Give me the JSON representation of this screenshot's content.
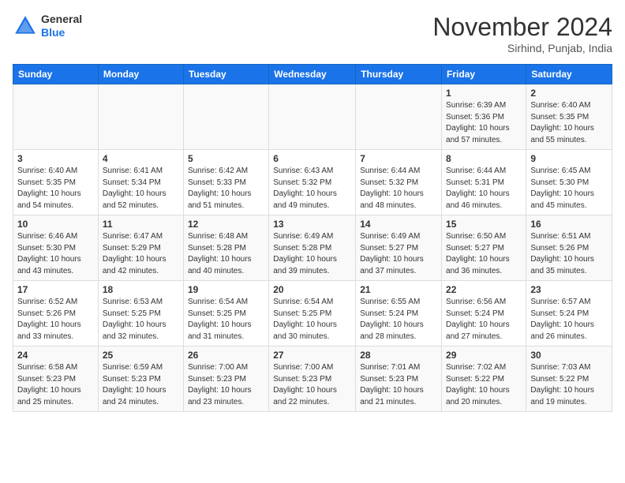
{
  "header": {
    "logo": {
      "general": "General",
      "blue": "Blue"
    },
    "title": "November 2024",
    "location": "Sirhind, Punjab, India"
  },
  "weekdays": [
    "Sunday",
    "Monday",
    "Tuesday",
    "Wednesday",
    "Thursday",
    "Friday",
    "Saturday"
  ],
  "weeks": [
    [
      {
        "day": "",
        "info": ""
      },
      {
        "day": "",
        "info": ""
      },
      {
        "day": "",
        "info": ""
      },
      {
        "day": "",
        "info": ""
      },
      {
        "day": "",
        "info": ""
      },
      {
        "day": "1",
        "info": "Sunrise: 6:39 AM\nSunset: 5:36 PM\nDaylight: 10 hours and 57 minutes."
      },
      {
        "day": "2",
        "info": "Sunrise: 6:40 AM\nSunset: 5:35 PM\nDaylight: 10 hours and 55 minutes."
      }
    ],
    [
      {
        "day": "3",
        "info": "Sunrise: 6:40 AM\nSunset: 5:35 PM\nDaylight: 10 hours and 54 minutes."
      },
      {
        "day": "4",
        "info": "Sunrise: 6:41 AM\nSunset: 5:34 PM\nDaylight: 10 hours and 52 minutes."
      },
      {
        "day": "5",
        "info": "Sunrise: 6:42 AM\nSunset: 5:33 PM\nDaylight: 10 hours and 51 minutes."
      },
      {
        "day": "6",
        "info": "Sunrise: 6:43 AM\nSunset: 5:32 PM\nDaylight: 10 hours and 49 minutes."
      },
      {
        "day": "7",
        "info": "Sunrise: 6:44 AM\nSunset: 5:32 PM\nDaylight: 10 hours and 48 minutes."
      },
      {
        "day": "8",
        "info": "Sunrise: 6:44 AM\nSunset: 5:31 PM\nDaylight: 10 hours and 46 minutes."
      },
      {
        "day": "9",
        "info": "Sunrise: 6:45 AM\nSunset: 5:30 PM\nDaylight: 10 hours and 45 minutes."
      }
    ],
    [
      {
        "day": "10",
        "info": "Sunrise: 6:46 AM\nSunset: 5:30 PM\nDaylight: 10 hours and 43 minutes."
      },
      {
        "day": "11",
        "info": "Sunrise: 6:47 AM\nSunset: 5:29 PM\nDaylight: 10 hours and 42 minutes."
      },
      {
        "day": "12",
        "info": "Sunrise: 6:48 AM\nSunset: 5:28 PM\nDaylight: 10 hours and 40 minutes."
      },
      {
        "day": "13",
        "info": "Sunrise: 6:49 AM\nSunset: 5:28 PM\nDaylight: 10 hours and 39 minutes."
      },
      {
        "day": "14",
        "info": "Sunrise: 6:49 AM\nSunset: 5:27 PM\nDaylight: 10 hours and 37 minutes."
      },
      {
        "day": "15",
        "info": "Sunrise: 6:50 AM\nSunset: 5:27 PM\nDaylight: 10 hours and 36 minutes."
      },
      {
        "day": "16",
        "info": "Sunrise: 6:51 AM\nSunset: 5:26 PM\nDaylight: 10 hours and 35 minutes."
      }
    ],
    [
      {
        "day": "17",
        "info": "Sunrise: 6:52 AM\nSunset: 5:26 PM\nDaylight: 10 hours and 33 minutes."
      },
      {
        "day": "18",
        "info": "Sunrise: 6:53 AM\nSunset: 5:25 PM\nDaylight: 10 hours and 32 minutes."
      },
      {
        "day": "19",
        "info": "Sunrise: 6:54 AM\nSunset: 5:25 PM\nDaylight: 10 hours and 31 minutes."
      },
      {
        "day": "20",
        "info": "Sunrise: 6:54 AM\nSunset: 5:25 PM\nDaylight: 10 hours and 30 minutes."
      },
      {
        "day": "21",
        "info": "Sunrise: 6:55 AM\nSunset: 5:24 PM\nDaylight: 10 hours and 28 minutes."
      },
      {
        "day": "22",
        "info": "Sunrise: 6:56 AM\nSunset: 5:24 PM\nDaylight: 10 hours and 27 minutes."
      },
      {
        "day": "23",
        "info": "Sunrise: 6:57 AM\nSunset: 5:24 PM\nDaylight: 10 hours and 26 minutes."
      }
    ],
    [
      {
        "day": "24",
        "info": "Sunrise: 6:58 AM\nSunset: 5:23 PM\nDaylight: 10 hours and 25 minutes."
      },
      {
        "day": "25",
        "info": "Sunrise: 6:59 AM\nSunset: 5:23 PM\nDaylight: 10 hours and 24 minutes."
      },
      {
        "day": "26",
        "info": "Sunrise: 7:00 AM\nSunset: 5:23 PM\nDaylight: 10 hours and 23 minutes."
      },
      {
        "day": "27",
        "info": "Sunrise: 7:00 AM\nSunset: 5:23 PM\nDaylight: 10 hours and 22 minutes."
      },
      {
        "day": "28",
        "info": "Sunrise: 7:01 AM\nSunset: 5:23 PM\nDaylight: 10 hours and 21 minutes."
      },
      {
        "day": "29",
        "info": "Sunrise: 7:02 AM\nSunset: 5:22 PM\nDaylight: 10 hours and 20 minutes."
      },
      {
        "day": "30",
        "info": "Sunrise: 7:03 AM\nSunset: 5:22 PM\nDaylight: 10 hours and 19 minutes."
      }
    ]
  ]
}
